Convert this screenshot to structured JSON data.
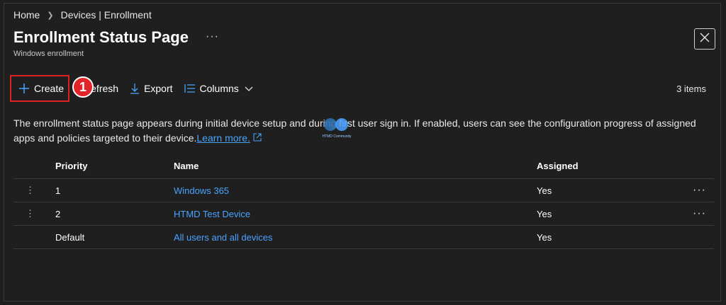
{
  "breadcrumb": {
    "home": "Home",
    "current": "Devices | Enrollment"
  },
  "header": {
    "title": "Enrollment Status Page",
    "subtitle": "Windows enrollment",
    "more": "···"
  },
  "toolbar": {
    "create": "Create",
    "refresh": "Refresh",
    "export": "Export",
    "columns": "Columns",
    "items_count": "3 items"
  },
  "badge": "1",
  "description": {
    "text": "The enrollment status page appears during initial device setup and during first user sign in. If enabled, users can see the configuration progress of assigned apps and policies targeted to their device.",
    "link": "Learn more."
  },
  "watermark": {
    "text": "HTMD Community"
  },
  "table": {
    "headers": {
      "priority": "Priority",
      "name": "Name",
      "assigned": "Assigned"
    },
    "rows": [
      {
        "priority": "1",
        "name": "Windows 365",
        "assigned": "Yes",
        "more": "···"
      },
      {
        "priority": "2",
        "name": "HTMD Test Device",
        "assigned": "Yes",
        "more": "···"
      },
      {
        "priority": "Default",
        "name": "All users and all devices",
        "assigned": "Yes",
        "more": ""
      }
    ]
  },
  "colors": {
    "background": "#1f1f1f",
    "link": "#4aa3ff",
    "highlight": "#e02020"
  }
}
